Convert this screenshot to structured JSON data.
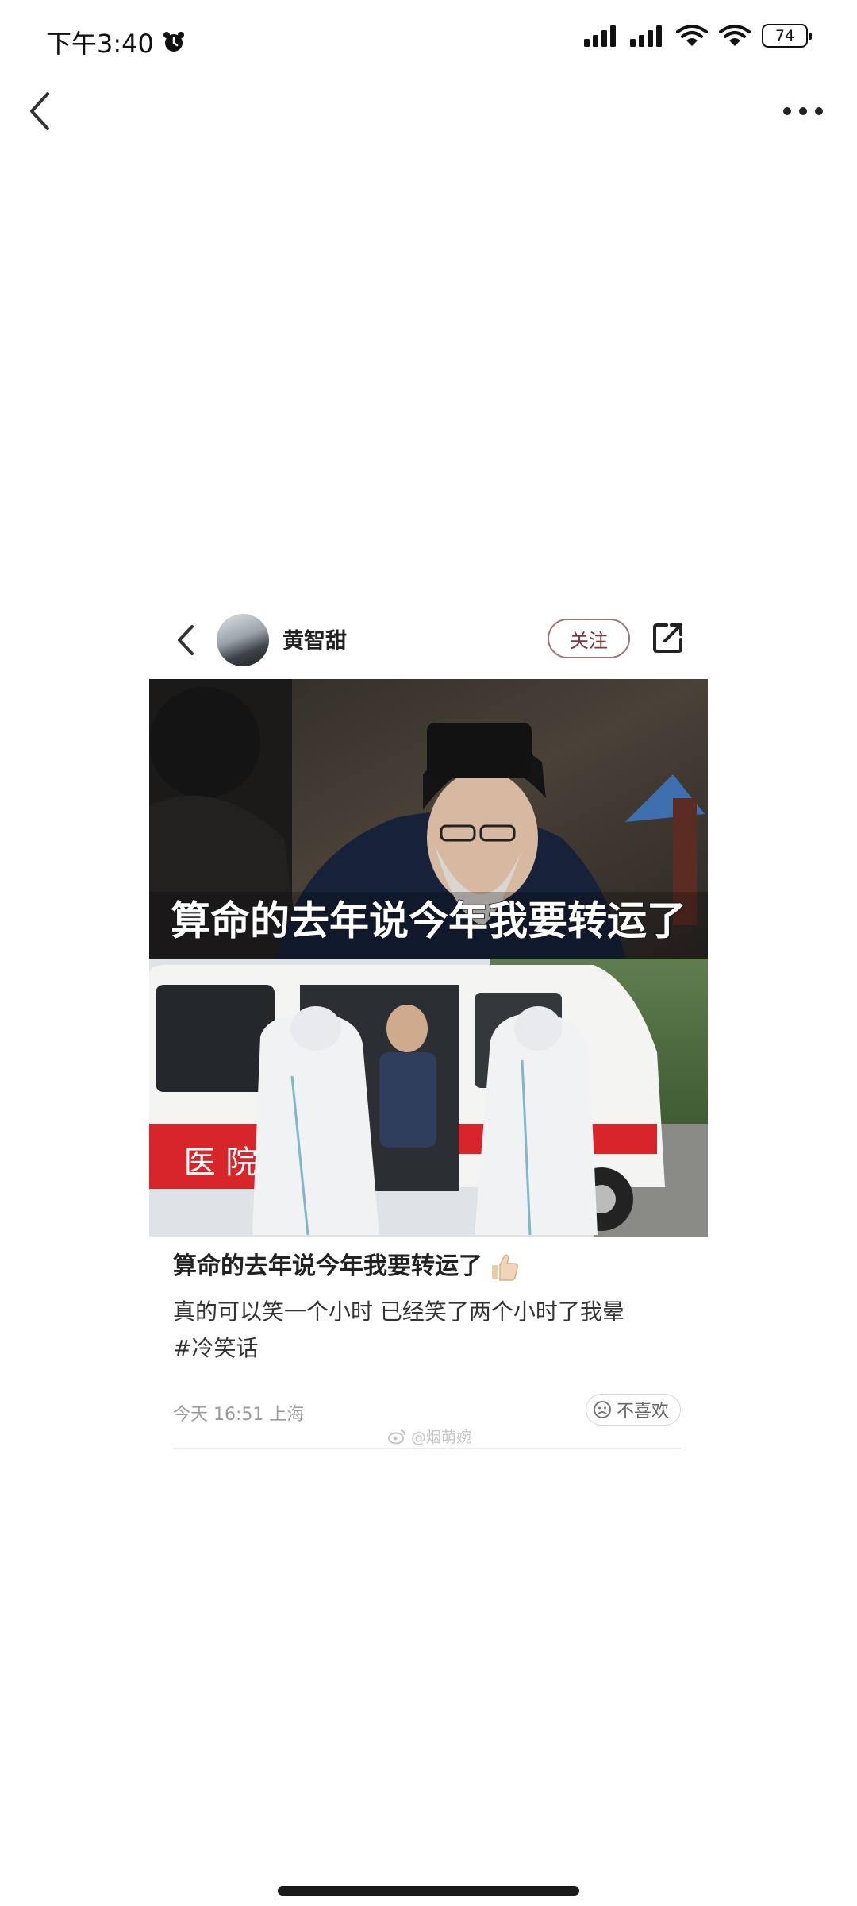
{
  "status_bar": {
    "time": "下午3:40",
    "battery": "74"
  },
  "nav": {
    "back_icon": "chevron-left-icon",
    "more_icon": "more-horizontal-icon"
  },
  "post": {
    "username": "黄智甜",
    "follow_label": "关注",
    "image_caption": "算命的去年说今年我要转运了",
    "ambulance_text": "医 院",
    "title": "算命的去年说今年我要转运了",
    "body": "真的可以笑一个小时 已经笑了两个小时了我晕",
    "tag": "#冷笑话",
    "meta": "今天 16:51 上海",
    "dislike_label": "不喜欢",
    "watermark": "@烟萌婉"
  },
  "colors": {
    "follow_border": "#a07276",
    "follow_text": "#7a3a40",
    "ambulance_red": "#d8252a"
  }
}
